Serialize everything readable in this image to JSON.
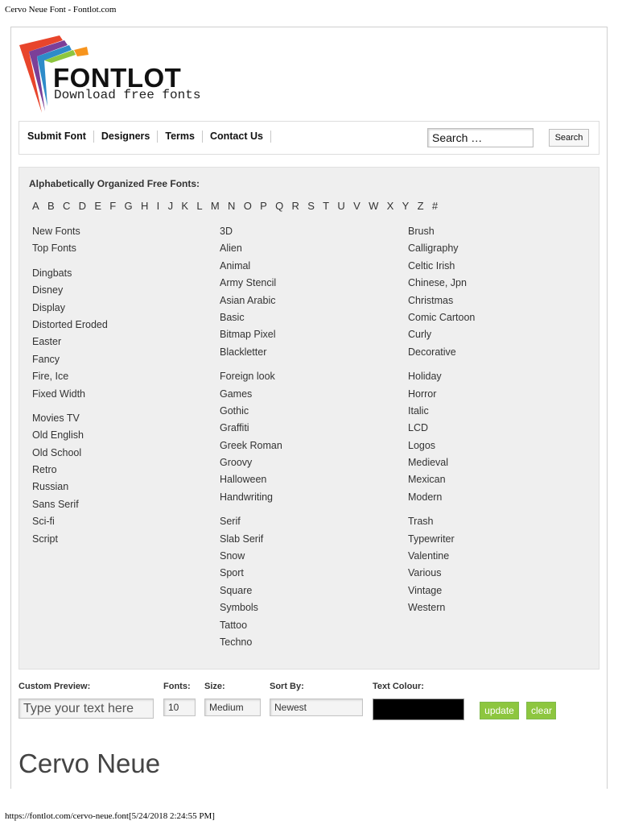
{
  "print_header": "Cervo Neue Font - Fontlot.com",
  "print_footer": "https://fontlot.com/cervo-neue.font[5/24/2018 2:24:55 PM]",
  "logo": {
    "name": "FONTLOT",
    "tagline": "Download free fonts"
  },
  "nav": {
    "links": [
      "Submit Font",
      "Designers",
      "Terms",
      "Contact Us"
    ],
    "search_placeholder": "Search …",
    "search_button": "Search"
  },
  "categories": {
    "heading": "Alphabetically Organized Free Fonts:",
    "letters": [
      "A",
      "B",
      "C",
      "D",
      "E",
      "F",
      "G",
      "H",
      "I",
      "J",
      "K",
      "L",
      "M",
      "N",
      "O",
      "P",
      "Q",
      "R",
      "S",
      "T",
      "U",
      "V",
      "W",
      "X",
      "Y",
      "Z",
      "#"
    ],
    "col1": [
      [
        "New Fonts",
        "Top Fonts"
      ],
      [
        "Dingbats",
        "Disney",
        "Display",
        "Distorted Eroded",
        "Easter",
        "Fancy",
        "Fire, Ice",
        "Fixed Width"
      ],
      [
        "Movies TV",
        "Old English",
        "Old School",
        "Retro",
        "Russian",
        "Sans Serif",
        "Sci-fi",
        "Script"
      ]
    ],
    "col2": [
      [
        "3D",
        "Alien",
        "Animal",
        "Army Stencil",
        "Asian Arabic",
        "Basic",
        "Bitmap Pixel",
        "Blackletter"
      ],
      [
        "Foreign look",
        "Games",
        "Gothic",
        "Graffiti",
        "Greek Roman",
        "Groovy",
        "Halloween",
        "Handwriting"
      ],
      [
        "Serif",
        "Slab Serif",
        "Snow",
        "Sport",
        "Square",
        "Symbols",
        "Tattoo",
        "Techno"
      ]
    ],
    "col3": [
      [
        "Brush",
        "Calligraphy",
        "Celtic Irish",
        "Chinese, Jpn",
        "Christmas",
        "Comic Cartoon",
        "Curly",
        "Decorative"
      ],
      [
        "Holiday",
        "Horror",
        "Italic",
        "LCD",
        "Logos",
        "Medieval",
        "Mexican",
        "Modern"
      ],
      [
        "Trash",
        "Typewriter",
        "Valentine",
        "Various",
        "Vintage",
        "Western"
      ]
    ]
  },
  "preview": {
    "custom_label": "Custom Preview:",
    "custom_placeholder": "Type your text here",
    "fonts_label": "Fonts:",
    "fonts_value": "10",
    "size_label": "Size:",
    "size_value": "Medium",
    "sort_label": "Sort By:",
    "sort_value": "Newest",
    "colour_label": "Text Colour:",
    "colour_value": "#000000",
    "update_label": "update",
    "clear_label": "clear",
    "button_color": "#8dc63f"
  },
  "font_title": "Cervo Neue",
  "colors": {
    "logo_red": "#e8452c",
    "logo_orange": "#f7941d",
    "logo_purple": "#7b3f98",
    "logo_blue": "#2e8bc9",
    "logo_green": "#8dc63f",
    "panel_bg": "#efefef"
  }
}
